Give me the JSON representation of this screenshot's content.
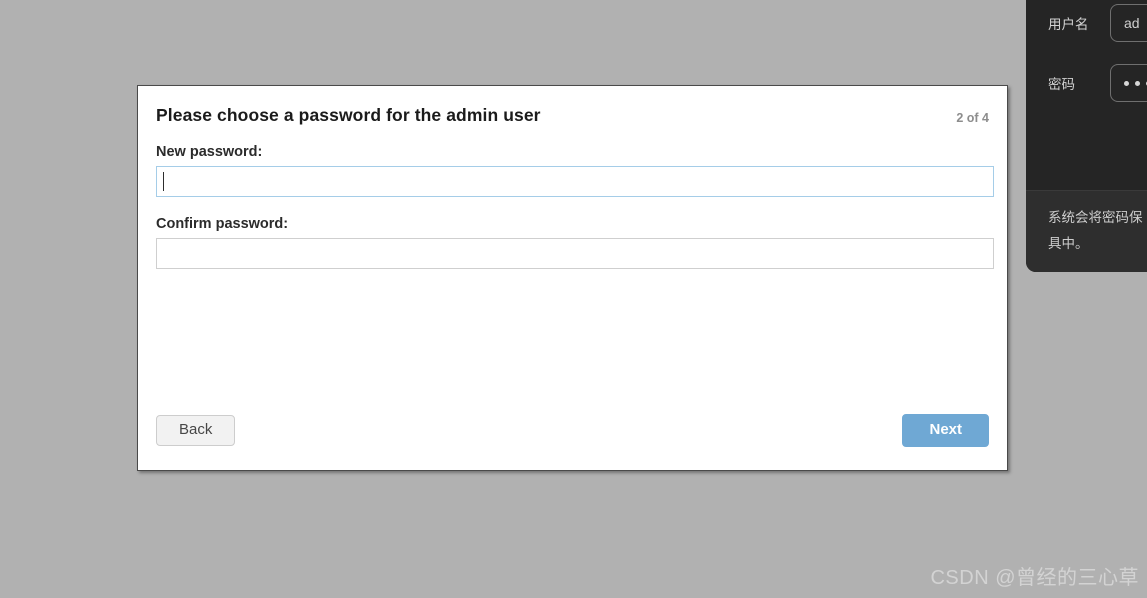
{
  "page": {
    "background_color": "#b1b1b1"
  },
  "wizard": {
    "title": "Please choose a password for the admin user",
    "step_indicator": "2 of 4",
    "fields": [
      {
        "label": "New password:",
        "value": "",
        "placeholder": "",
        "focused": true
      },
      {
        "label": "Confirm password:",
        "value": "",
        "placeholder": "",
        "focused": false
      }
    ],
    "buttons": {
      "back_label": "Back",
      "next_label": "Next",
      "next_color": "#6fa8d4"
    }
  },
  "dark_panel": {
    "username_label": "用户名",
    "username_value": "ad",
    "password_label": "密码",
    "password_masked_dots": 3,
    "note_line1": "系统会将密码保",
    "note_line2": "具中。"
  },
  "watermark": {
    "text": "CSDN @曾经的三心草"
  }
}
